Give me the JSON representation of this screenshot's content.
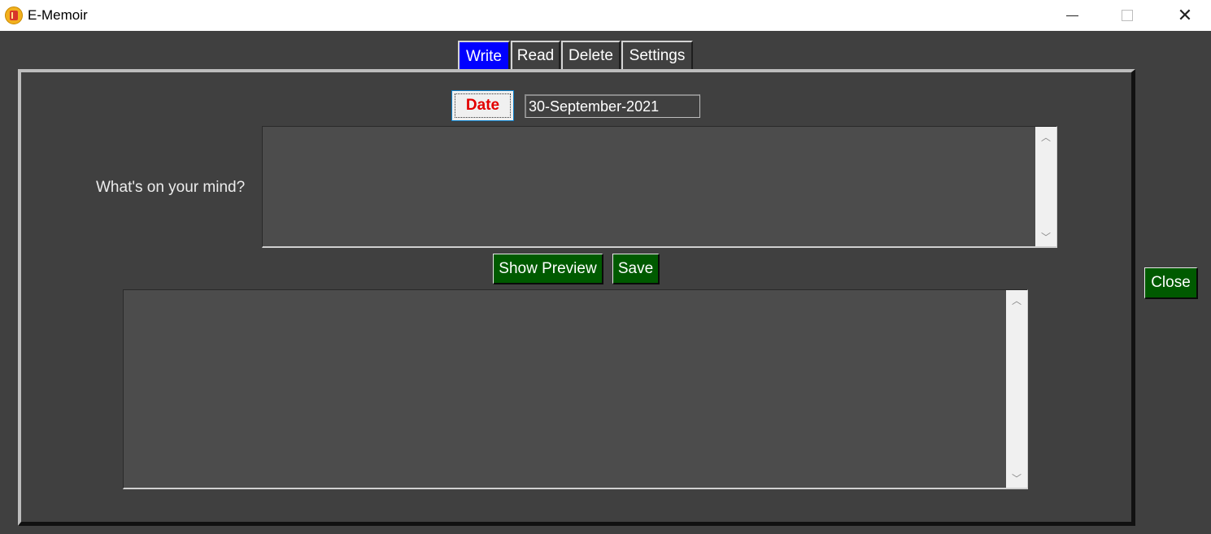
{
  "window": {
    "title": "E-Memoir",
    "minimize_icon": "minimize-icon",
    "maximize_icon": "maximize-icon",
    "close_glyph": "✕"
  },
  "tabs": [
    {
      "label": "Write",
      "active": true
    },
    {
      "label": "Read",
      "active": false
    },
    {
      "label": "Delete",
      "active": false
    },
    {
      "label": "Settings",
      "active": false
    }
  ],
  "write": {
    "date_button": "Date",
    "date_value": "30-September-2021",
    "prompt_label": "What's on your mind?",
    "entry_text": "",
    "show_preview_button": "Show Preview",
    "save_button": "Save",
    "preview_text": ""
  },
  "close_button": "Close",
  "colors": {
    "active_tab": "#0000ff",
    "button_green": "#005a00",
    "date_label": "#e30000",
    "background": "#404040"
  }
}
